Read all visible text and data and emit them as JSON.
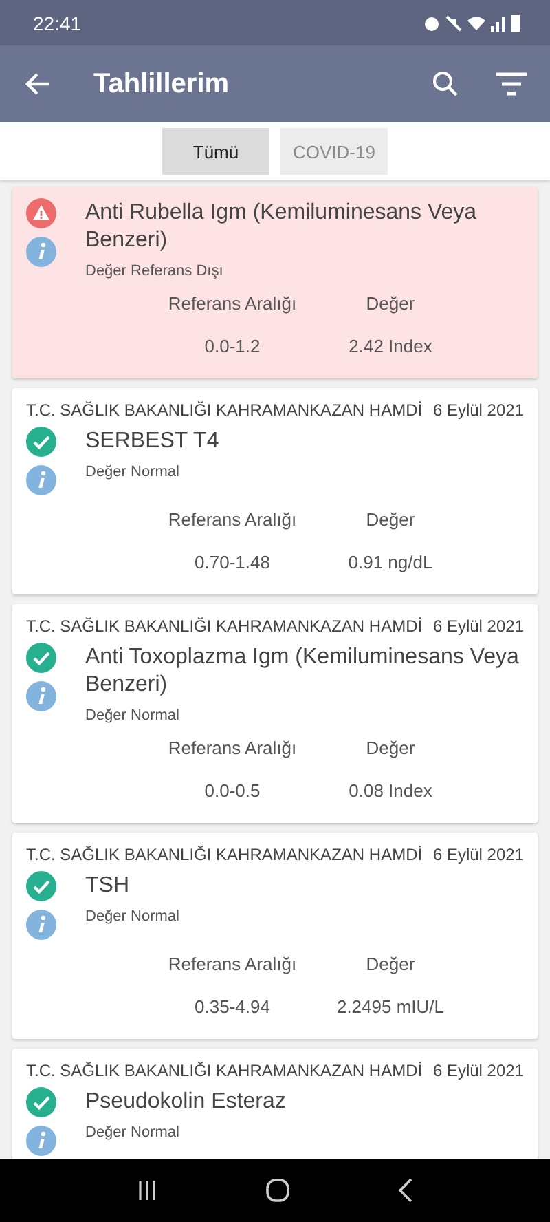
{
  "status_bar": {
    "time": "22:41"
  },
  "app_bar": {
    "title": "Tahlillerim"
  },
  "tabs": [
    {
      "label": "Tümü",
      "selected": true
    },
    {
      "label": "COVID-19",
      "selected": false
    }
  ],
  "results": [
    {
      "kind": "abnormal",
      "title": "Anti Rubella Igm (Kemiluminesans Veya Benzeri)",
      "status": "Değer Referans Dışı",
      "range_label": "Referans Aralığı",
      "value_label": "Değer",
      "range": "0.0-1.2",
      "value": "2.42 Index"
    },
    {
      "kind": "normal",
      "institution": "T.C. SAĞLIK BAKANLIĞI KAHRAMANKAZAN HAMDİ",
      "date": "6 Eylül 2021",
      "title": "SERBEST T4",
      "status": "Değer Normal",
      "range_label": "Referans Aralığı",
      "value_label": "Değer",
      "range": "0.70-1.48",
      "value": "0.91 ng/dL"
    },
    {
      "kind": "normal",
      "institution": "T.C. SAĞLIK BAKANLIĞI KAHRAMANKAZAN HAMDİ",
      "date": "6 Eylül 2021",
      "title": "Anti Toxoplazma Igm (Kemiluminesans Veya Benzeri)",
      "status": "Değer Normal",
      "range_label": "Referans Aralığı",
      "value_label": "Değer",
      "range": "0.0-0.5",
      "value": "0.08 Index"
    },
    {
      "kind": "normal",
      "institution": "T.C. SAĞLIK BAKANLIĞI KAHRAMANKAZAN HAMDİ",
      "date": "6 Eylül 2021",
      "title": "TSH",
      "status": "Değer Normal",
      "range_label": "Referans Aralığı",
      "value_label": "Değer",
      "range": "0.35-4.94",
      "value": "2.2495 mIU/L"
    },
    {
      "kind": "normal",
      "institution": "T.C. SAĞLIK BAKANLIĞI KAHRAMANKAZAN HAMDİ",
      "date": "6 Eylül 2021",
      "title": "Pseudokolin Esteraz",
      "status": "Değer Normal"
    }
  ]
}
